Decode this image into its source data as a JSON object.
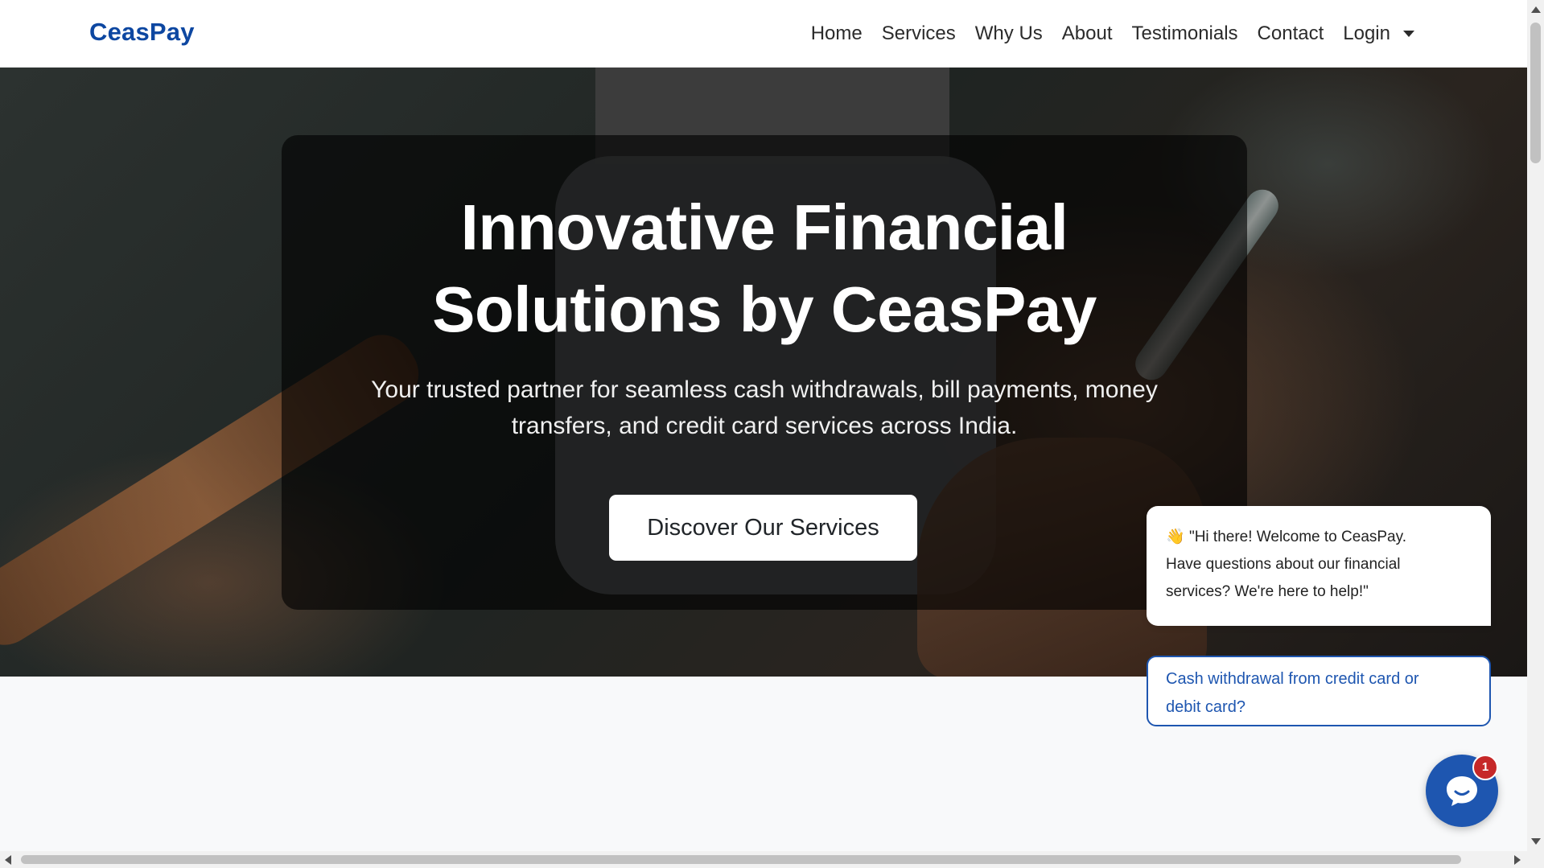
{
  "navbar": {
    "brand": "CeasPay",
    "links": [
      "Home",
      "Services",
      "Why Us",
      "About",
      "Testimonials",
      "Contact"
    ],
    "login": "Login"
  },
  "hero": {
    "title_line1": "Innovative Financial",
    "title_line2": "Solutions by CeasPay",
    "subtitle_line1": "Your trusted partner for seamless cash withdrawals, bill payments, money",
    "subtitle_line2": "transfers, and credit card services across India.",
    "cta": "Discover Our Services"
  },
  "chat": {
    "greeting_emoji": "👋",
    "greeting_line1": "\"Hi there! Welcome to CeasPay.",
    "greeting_line2": "Have questions about our financial",
    "greeting_line3": "services? We're here to help!\"",
    "option_line1": "Cash withdrawal from credit card or",
    "option_line2": "debit card?",
    "badge_count": "1"
  },
  "colors": {
    "brand": "#0d47a1",
    "chat_accent": "#1e56b0",
    "badge": "#c62828"
  }
}
